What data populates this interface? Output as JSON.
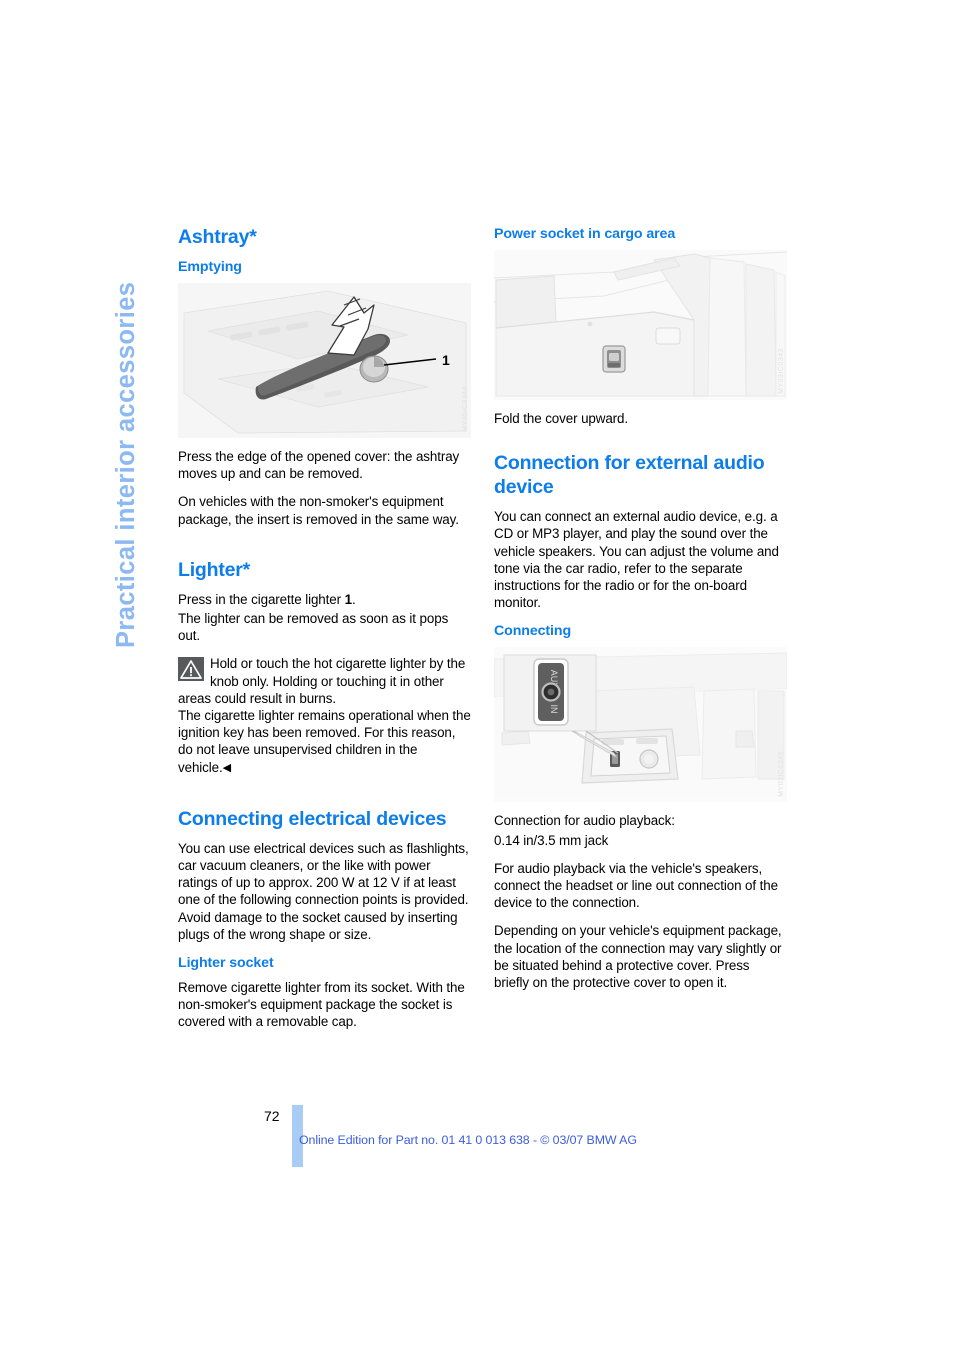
{
  "document": {
    "running_head": "Practical interior accessories",
    "page_number": "72",
    "footer_text": "Online Edition for Part no. 01 41 0 013 638 - © 03/07 BMW AG",
    "accent_color": "#0d7dea",
    "running_head_color": "#8cb9f2",
    "footer_color": "#3b5dde",
    "footer_bar_color": "#a9ccf5"
  },
  "left_column": {
    "ashtray": {
      "heading": "Ashtray*",
      "subheading": "Emptying",
      "figure": {
        "name": "ashtray-illustration",
        "callout_label": "1",
        "watermark": "MY05IC0344"
      },
      "paragraphs": [
        "Press the edge of the opened cover: the ashtray moves up and can be removed.",
        "On vehicles with the non-smoker's equipment package, the insert is removed in the same way."
      ]
    },
    "lighter": {
      "heading": "Lighter*",
      "line1_a": "Press in the cigarette lighter ",
      "line1_num": "1",
      "line1_b": ".",
      "line2": "The lighter can be removed as soon as it pops out.",
      "warning": "Hold or touch the hot cigarette lighter by the knob only. Holding or touching it in other areas could result in burns.",
      "warning_icon": "warning-triangle-icon",
      "after_warning": "The cigarette lighter remains operational when the ignition key has been removed. For this reason, do not leave unsupervised children in the vehicle.",
      "backref_symbol": "◀"
    },
    "connecting_electrical": {
      "heading": "Connecting electrical devices",
      "paragraph": "You can use electrical devices such as flashlights, car vacuum cleaners, or the like with power ratings of up to approx. 200 W at 12 V if at least one of the following connection points is provided. Avoid damage to the socket caused by inserting plugs of the wrong shape or size.",
      "subheading": "Lighter socket",
      "sub_paragraph": "Remove cigarette lighter from its socket. With the non-smoker's equipment package the socket is covered with a removable cap."
    }
  },
  "right_column": {
    "power_socket": {
      "subheading": "Power socket in cargo area",
      "figure": {
        "name": "cargo-area-power-socket-illustration",
        "watermark": "MY03IC0343"
      },
      "caption": "Fold the cover upward."
    },
    "audio_device": {
      "heading": "Connection for external audio device",
      "paragraph": "You can connect an external audio device, e.g. a CD or MP3 player, and play the sound over the vehicle speakers. You can adjust the volume and tone via the car radio, refer to the separate instructions for the radio or for the on-board monitor.",
      "subheading": "Connecting",
      "figure": {
        "name": "aux-in-jack-illustration",
        "label_top": "AUX",
        "label_bottom": "IN",
        "watermark": "MY03IC0345"
      },
      "caption_line1": "Connection for audio playback:",
      "caption_line2": "0.14 in/3.5 mm jack",
      "paragraph2": "For audio playback via the vehicle's speakers, connect the headset or line out connection of the device to the connection.",
      "paragraph3": "Depending on your vehicle's equipment package, the location of the connection may vary slightly or be situated behind a protective cover. Press briefly on the protective cover to open it."
    }
  }
}
